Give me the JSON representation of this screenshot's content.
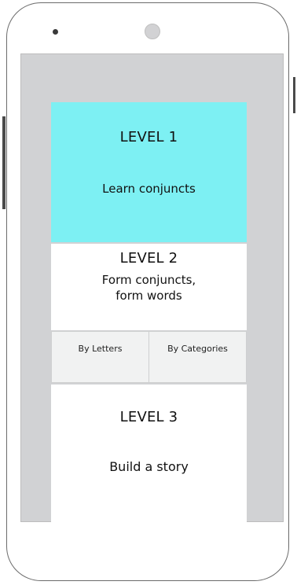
{
  "levels": {
    "level1": {
      "title": "LEVEL 1",
      "description": "Learn conjuncts"
    },
    "level2": {
      "title": "LEVEL 2",
      "description_line1": "Form conjuncts,",
      "description_line2": "form words",
      "options": [
        {
          "label": "By Letters"
        },
        {
          "label": "By Categories"
        }
      ]
    },
    "level3": {
      "title": "LEVEL 3",
      "description": "Build a story"
    }
  },
  "colors": {
    "level1_background": "#7df0f3",
    "screen_background": "#d1d2d4",
    "card_background": "#ffffff",
    "option_background": "#f1f2f2"
  }
}
